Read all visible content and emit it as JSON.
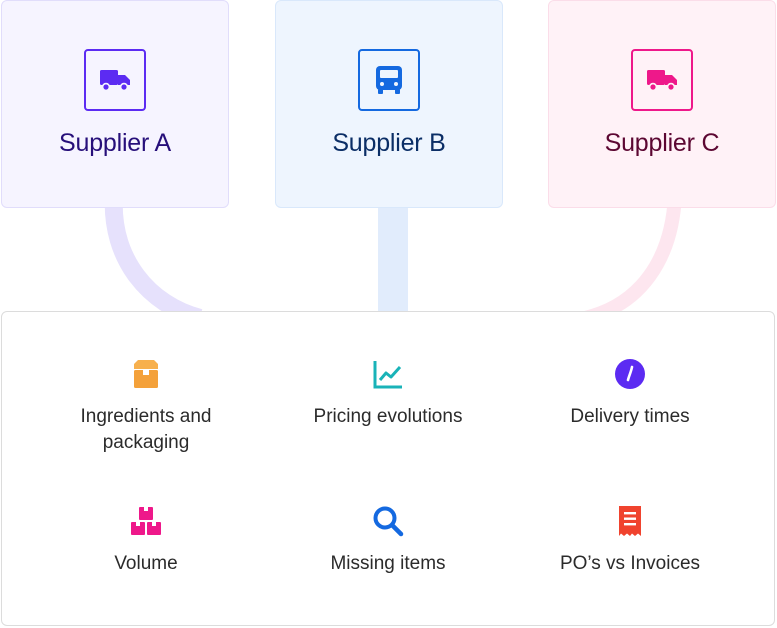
{
  "suppliers": [
    {
      "name": "Supplier A",
      "icon": "delivery-truck-icon",
      "accent": "#5c2bf2"
    },
    {
      "name": "Supplier B",
      "icon": "bus-front-icon",
      "accent": "#1469e0"
    },
    {
      "name": "Supplier C",
      "icon": "delivery-truck-icon",
      "accent": "#ee188a"
    }
  ],
  "features": [
    {
      "label": "Ingredients and packaging",
      "icon": "box-icon",
      "color": "#f4a13a"
    },
    {
      "label": "Pricing evolutions",
      "icon": "line-chart-icon",
      "color": "#19b3b8"
    },
    {
      "label": "Delivery times",
      "icon": "clock-icon",
      "color": "#5c2bf2"
    },
    {
      "label": "Volume",
      "icon": "stacked-boxes-icon",
      "color": "#ee188a"
    },
    {
      "label": "Missing items",
      "icon": "magnifier-icon",
      "color": "#1469e0"
    },
    {
      "label": "PO’s vs Invoices",
      "icon": "receipt-icon",
      "color": "#f0432e"
    }
  ]
}
